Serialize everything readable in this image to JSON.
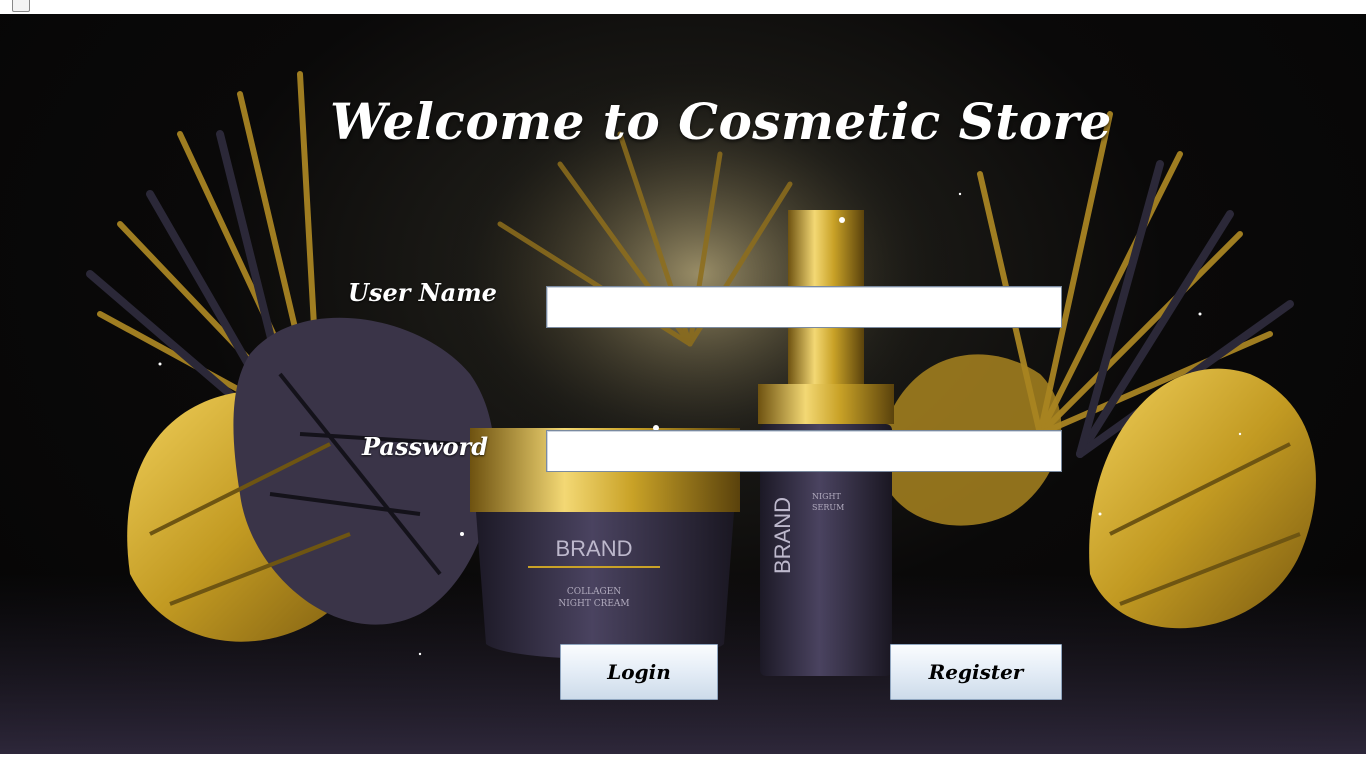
{
  "login_form": {
    "title": "Welcome to Cosmetic Store",
    "username_label": "User Name",
    "username_value": "",
    "password_label": "Password",
    "password_value": "",
    "login_button": "Login",
    "register_button": "Register"
  },
  "background": {
    "jar_brand": "BRAND",
    "jar_line1": "COLLAGEN",
    "jar_line2": "NIGHT CREAM",
    "bottle_brand": "BRAND",
    "bottle_line1": "NIGHT",
    "bottle_line2": "SERUM",
    "colors": {
      "gold": "#c9a227",
      "dark": "#0a0909",
      "purple": "#3c3550"
    }
  }
}
